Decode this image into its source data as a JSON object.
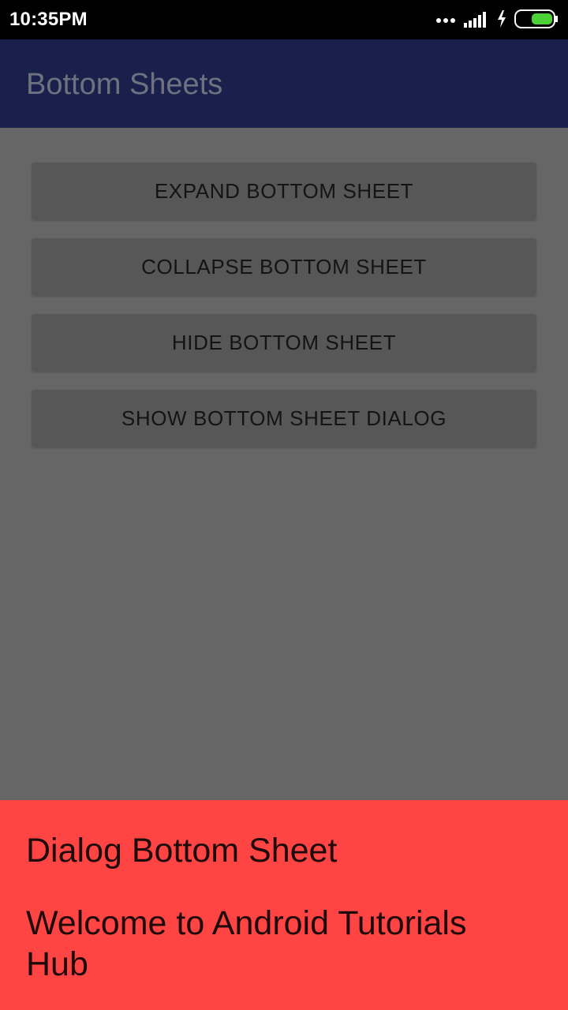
{
  "status_bar": {
    "time": "10:35PM",
    "icons": [
      "more-dots-icon",
      "signal-icon",
      "charging-icon",
      "battery-icon"
    ]
  },
  "app_bar": {
    "title": "Bottom Sheets"
  },
  "buttons": [
    {
      "label": "EXPAND BOTTOM SHEET"
    },
    {
      "label": "COLLAPSE BOTTOM SHEET"
    },
    {
      "label": "HIDE BOTTOM SHEET"
    },
    {
      "label": "SHOW BOTTOM SHEET DIALOG"
    }
  ],
  "bottom_sheet": {
    "title": "Dialog Bottom Sheet",
    "message": "Welcome to Android Tutorials Hub"
  },
  "colors": {
    "app_bar": "#19204b",
    "background_dimmed": "#666666",
    "button": "#575757",
    "sheet": "#ff4444",
    "battery_fill": "#4cd137"
  }
}
